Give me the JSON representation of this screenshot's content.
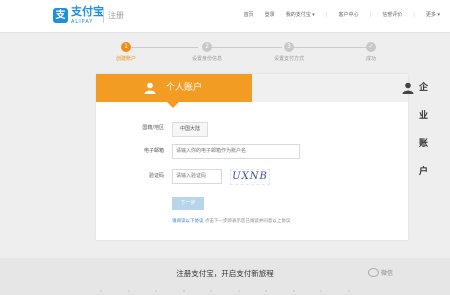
{
  "header": {
    "logo_icon": "支",
    "logo_name": "支付宝",
    "logo_en": "ALIPAY",
    "register_label": "注册",
    "nav": [
      "首页",
      "登录",
      "我的支付宝 ▾",
      "客户中心",
      "信誉评价",
      "更多 ▾"
    ]
  },
  "steps": [
    {
      "number": "1",
      "label": "创建账户",
      "active": true
    },
    {
      "number": "2",
      "label": "设置身份信息",
      "active": false
    },
    {
      "number": "3",
      "label": "设置支付方式",
      "active": false
    },
    {
      "number": "4",
      "label": "成功",
      "active": false
    }
  ],
  "tabs": {
    "personal": "个人账户",
    "company": "企业账户"
  },
  "form": {
    "region_label": "国籍/地区",
    "region_value": "中国大陆",
    "email_label": "电子邮箱",
    "email_placeholder": "请输入你的电子邮箱作为账户名",
    "captcha_label": "验证码",
    "captcha_placeholder": "请输入验证码",
    "captcha_text": "UXNB",
    "next_button": "下一步",
    "agree_prefix": "请阅读以下协议",
    "agree_suffix": "点击下一步即表示您已阅读并同意以上协议"
  },
  "footer": {
    "title": "注册支付宝，开启支付新旅程",
    "wechat_label": "微信"
  },
  "colors": {
    "accent": "#f39c24",
    "brand": "#1a8fe3"
  }
}
